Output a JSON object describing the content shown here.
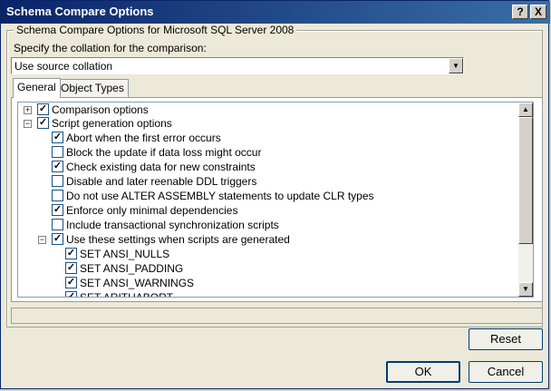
{
  "window": {
    "title": "Schema Compare Options",
    "help_label": "?",
    "close_label": "X"
  },
  "group": {
    "title": "Schema Compare Options for Microsoft SQL Server 2008"
  },
  "collation": {
    "label": "Specify the collation for the comparison:",
    "selected": "Use source collation"
  },
  "tabs": [
    {
      "label": "General",
      "active": true
    },
    {
      "label": "Object Types",
      "active": false
    }
  ],
  "tree": [
    {
      "label": "Comparison options",
      "checked": true,
      "expander": "+"
    },
    {
      "label": "Script generation options",
      "checked": true,
      "expander": "−"
    },
    {
      "label": "Abort when the first error occurs",
      "checked": true
    },
    {
      "label": "Block the update if data loss might occur",
      "checked": false
    },
    {
      "label": "Check existing data for new constraints",
      "checked": true
    },
    {
      "label": "Disable and later reenable DDL triggers",
      "checked": false
    },
    {
      "label": "Do not use ALTER ASSEMBLY statements to update CLR types",
      "checked": false
    },
    {
      "label": "Enforce only minimal dependencies",
      "checked": true
    },
    {
      "label": "Include transactional synchronization scripts",
      "checked": false
    },
    {
      "label": "Use these settings when scripts are generated",
      "checked": true,
      "expander": "−"
    },
    {
      "label": "SET ANSI_NULLS",
      "checked": true
    },
    {
      "label": "SET ANSI_PADDING",
      "checked": true
    },
    {
      "label": "SET ANSI_WARNINGS",
      "checked": true
    },
    {
      "label": "SET ARITHABORT",
      "checked": true
    }
  ],
  "buttons": {
    "reset": "Reset",
    "ok": "OK",
    "cancel": "Cancel"
  },
  "check_glyph": "✓"
}
